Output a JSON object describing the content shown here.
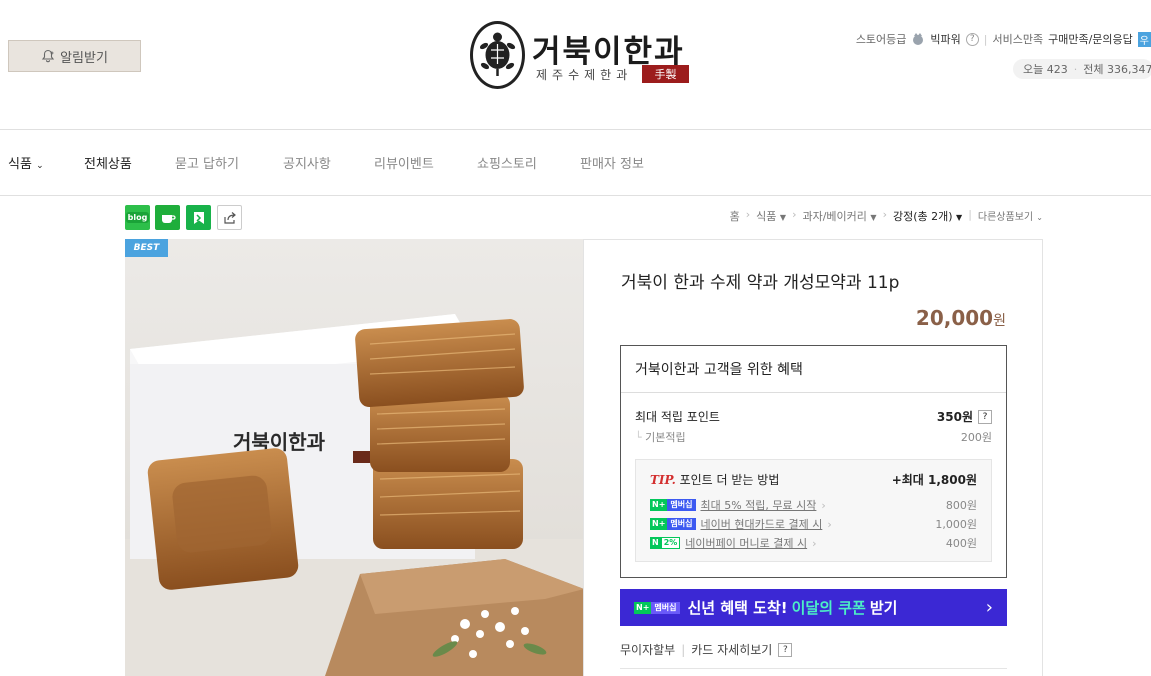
{
  "header": {
    "alarm_label": "알림받기",
    "logo_title": "거북이한과",
    "logo_sub": "제주수제한과",
    "logo_seal": "手製",
    "store_grade_label": "스토어등급",
    "store_grade_value": "빅파워",
    "service_label": "서비스만족",
    "service_value": "구매만족/문의응답",
    "service_badge": "우",
    "visit_today": "오늘 423",
    "visit_total": "전체 336,347"
  },
  "nav": {
    "items": [
      "식품",
      "전체상품",
      "묻고 답하기",
      "공지사항",
      "리뷰이벤트",
      "쇼핑스토리",
      "판매자 정보"
    ]
  },
  "share": {
    "blog": "blog",
    "icons": [
      "blog-icon",
      "cafe-icon",
      "keep-icon",
      "share-icon"
    ]
  },
  "breadcrumb": {
    "items": [
      "홈",
      "식품",
      "과자/베이커리",
      "강정(총 2개)",
      "다른상품보기"
    ]
  },
  "product": {
    "badge": "BEST",
    "title": "거북이 한과 수제 약과 개성모약과 11p",
    "price": "20,000",
    "price_unit": "원"
  },
  "benefit": {
    "header": "거북이한과 고객을 위한 혜택",
    "max_point_label": "최대 적립 포인트",
    "max_point_value": "350원",
    "basic_label": "기본적립",
    "basic_value": "200원",
    "tip_prefix": "TIP.",
    "tip_label": "포인트 더 받는 방법",
    "tip_max": "+최대 1,800원",
    "rows": [
      {
        "label": "최대 5% 적립, 무료 시작",
        "value": "800원",
        "badge": "멤버십"
      },
      {
        "label": "네이버 현대카드로 결제 시",
        "value": "1,000원",
        "badge": "멤버십"
      },
      {
        "label": "네이버페이 머니로 결제 시",
        "value": "400원",
        "badge": "2%"
      }
    ]
  },
  "coupon": {
    "badge": "멤버십",
    "text": "신년 혜택 도착!",
    "highlight": "이달의 쿠폰",
    "suffix": "받기",
    "arrow": "›"
  },
  "links": {
    "installment": "무이자할부",
    "card_detail": "카드 자세히보기"
  },
  "colors": {
    "price": "#8a6048",
    "coupon_bg": "#3b28d4",
    "naver_green": "#03c75a",
    "best_badge": "#4ba3df"
  }
}
